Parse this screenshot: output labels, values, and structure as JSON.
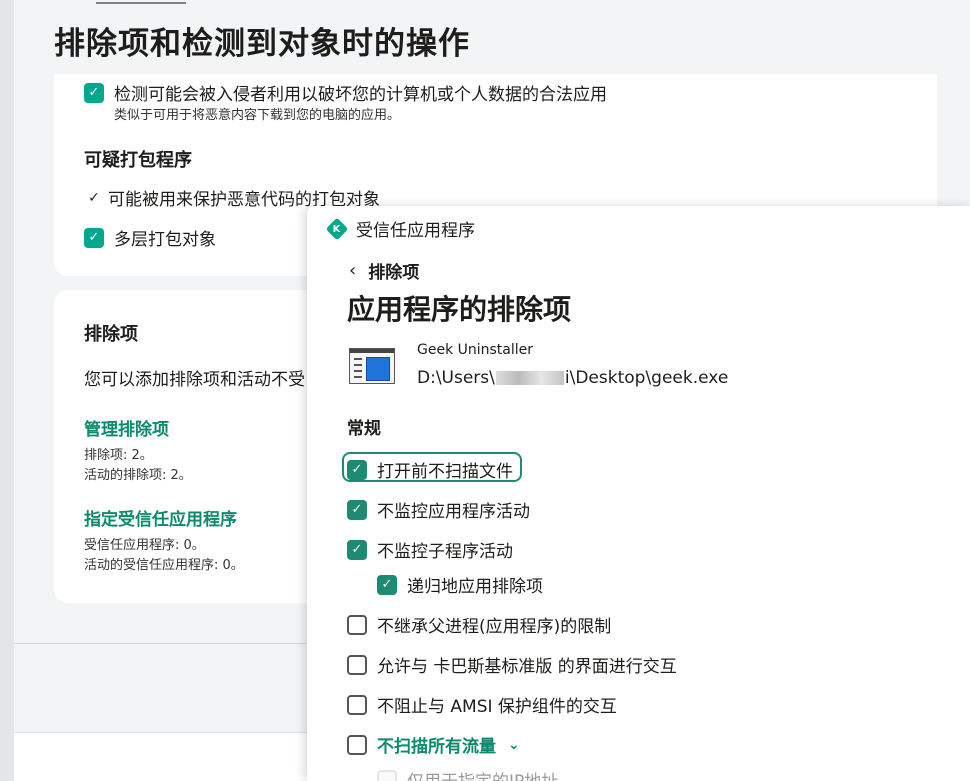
{
  "background": {
    "page_title": "排除项和检测到对象时的操作",
    "card1": {
      "item1_label": "检测可能会被入侵者利用以破坏您的计算机或个人数据的合法应用",
      "item1_sub": "类似于可用于将恶意内容下载到您的电脑的应用。",
      "section_title": "可疑打包程序",
      "item2_label": "可能被用来保护恶意代码的打包对象",
      "item3_label": "多层打包对象"
    },
    "card2": {
      "title": "排除项",
      "description": "您可以添加排除项和活动不受",
      "manage_link": "管理排除项",
      "exclusions_count": "排除项: 2。",
      "active_exclusions_count": "活动的排除项: 2。",
      "trusted_link": "指定受信任应用程序",
      "trusted_count": "受信任应用程序: 0。",
      "active_trusted_count": "活动的受信任应用程序: 0。"
    }
  },
  "panel": {
    "window_title": "受信任应用程序",
    "back_label": "排除项",
    "title": "应用程序的排除项",
    "app_name": "Geek Uninstaller",
    "app_path_prefix": "D:\\Users\\",
    "app_path_suffix": "i\\Desktop\\geek.exe",
    "section_general": "常规",
    "options": [
      {
        "label": "打开前不扫描文件",
        "checked": true
      },
      {
        "label": "不监控应用程序活动",
        "checked": true
      },
      {
        "label": "不监控子程序活动",
        "checked": true
      },
      {
        "label": "递归地应用排除项",
        "checked": true
      },
      {
        "label": "不继承父进程(应用程序)的限制",
        "checked": false
      },
      {
        "label": "允许与 卡巴斯基标准版 的界面进行交互",
        "checked": false
      },
      {
        "label": "不阻止与 AMSI 保护组件的交互",
        "checked": false
      },
      {
        "label": "不扫描所有流量",
        "checked": false
      },
      {
        "label": "仅用于指定的IP地址",
        "checked": false
      }
    ]
  },
  "icons": {
    "check": "✓",
    "back": "‹",
    "expand": "⌄"
  },
  "colors": {
    "accent": "#00a88e",
    "link": "#0c8a6e"
  }
}
